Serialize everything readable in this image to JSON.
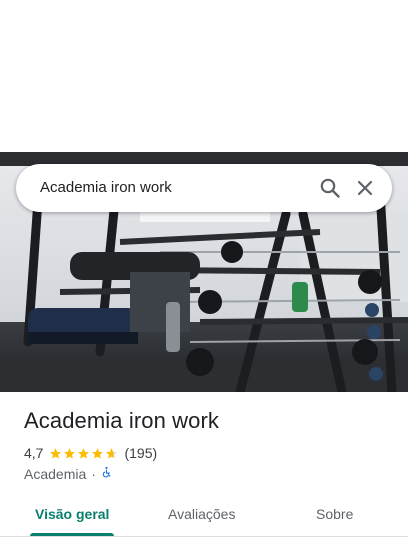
{
  "search": {
    "query": "Academia iron work",
    "search_icon": "search-icon",
    "close_icon": "close-icon"
  },
  "photo": {
    "icon": "gym-photo"
  },
  "place": {
    "name": "Academia iron work",
    "rating": "4,7",
    "rating_stars": 4.7,
    "reviews": "(195)",
    "category": "Academia",
    "separator": "·",
    "accessibility_icon": "wheelchair-icon"
  },
  "tabs": [
    {
      "label": "Visão geral",
      "active": true
    },
    {
      "label": "Avaliações",
      "active": false
    },
    {
      "label": "Sobre",
      "active": false
    }
  ],
  "colors": {
    "accent": "#0b7f6e",
    "star": "#fbbc04",
    "accessibility": "#1a73e8"
  }
}
